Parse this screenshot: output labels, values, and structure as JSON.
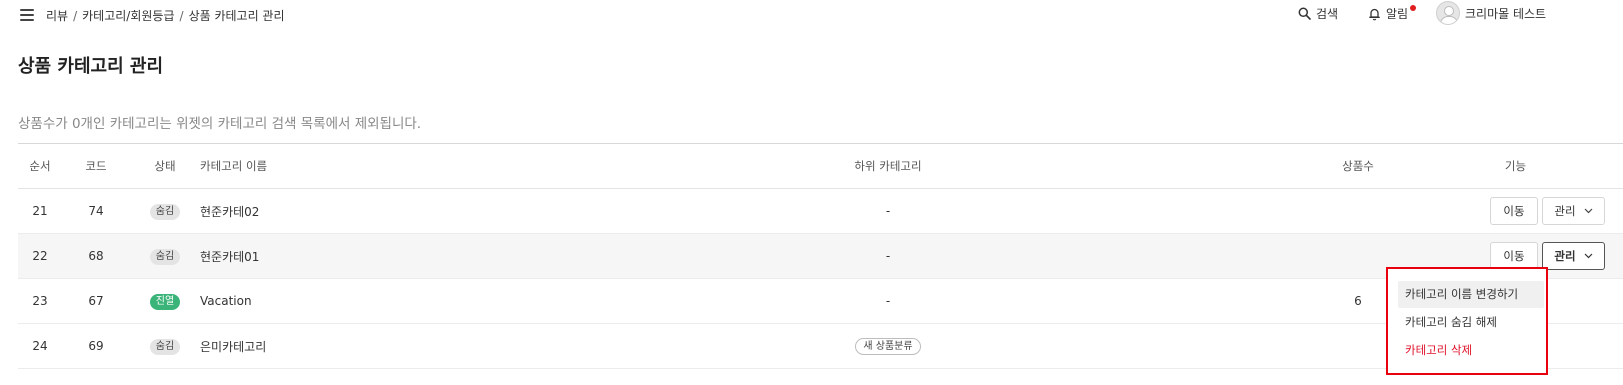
{
  "breadcrumb": [
    "리뷰",
    "카테고리/회원등급",
    "상품 카테고리 관리"
  ],
  "breadcrumb_separator": "/",
  "header": {
    "search_label": "검색",
    "alarm_label": "알림",
    "user_name": "크리마몰 테스트"
  },
  "page_title": "상품 카테고리 관리",
  "notice": "상품수가 0개인 카테고리는 위젯의 카테고리 검색 목록에서 제외됩니다.",
  "table": {
    "columns": [
      "순서",
      "코드",
      "상태",
      "카테고리 이름",
      "하위 카테고리",
      "상품수",
      "기능"
    ],
    "rows": [
      {
        "order": "21",
        "code": "74",
        "status": "숨김",
        "name": "현준카테02",
        "sub": "-",
        "count": ""
      },
      {
        "order": "22",
        "code": "68",
        "status": "숨김",
        "name": "현준카테01",
        "sub": "-",
        "count": ""
      },
      {
        "order": "23",
        "code": "67",
        "status": "진열",
        "name": "Vacation",
        "sub": "-",
        "count": "6"
      },
      {
        "order": "24",
        "code": "69",
        "status": "숨김",
        "name": "은미카테고리",
        "sub": "새 상품분류",
        "count": ""
      }
    ],
    "move_label": "이동",
    "manage_label": "관리"
  },
  "dropdown": {
    "items": [
      "카테고리 이름 변경하기",
      "카테고리 숨김 해제",
      "카테고리 삭제"
    ]
  },
  "colors": {
    "status_shown": "#3bb47a",
    "danger": "#e0102a",
    "highlight_border": "#e8000e",
    "alarm_dot": "#e02020"
  }
}
